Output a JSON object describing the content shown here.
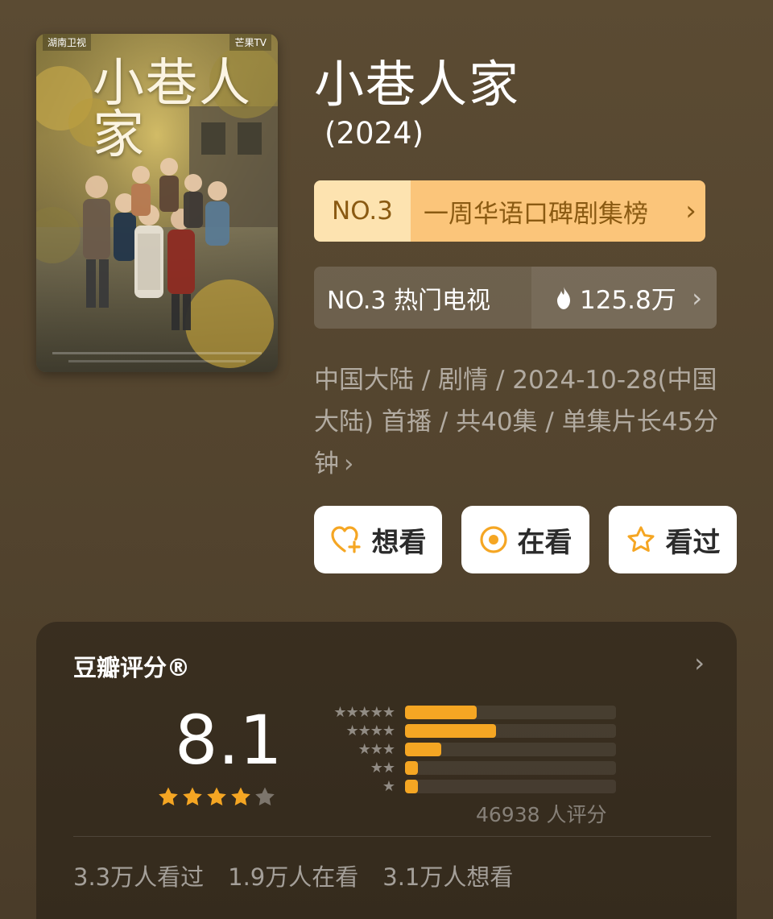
{
  "poster": {
    "title_text": "小巷人家",
    "top_left_text": "湖南卫视",
    "top_right_text": "芒果TV"
  },
  "title": "小巷人家",
  "year": "(2024)",
  "rank_chip": {
    "no": "NO.3",
    "label": "一周华语口碑剧集榜",
    "chevron": "›"
  },
  "hot_chip": {
    "label": "NO.3 热门电视",
    "value": "125.8万",
    "icon": "flame-icon",
    "chevron": "›"
  },
  "meta": {
    "text": "中国大陆 / 剧情 / 2024-10-28(中国大陆) 首播 / 共40集 / 单集片长45分钟",
    "chevron": "›"
  },
  "actions": [
    {
      "label": "想看",
      "icon": "heart-plus-icon"
    },
    {
      "label": "在看",
      "icon": "target-circle-icon"
    },
    {
      "label": "看过",
      "icon": "star-outline-icon"
    }
  ],
  "rating": {
    "title": "豆瓣评分®",
    "chevron": "›",
    "score": "8.1",
    "stars_filled": 4,
    "stars_total": 5,
    "distribution": [
      {
        "stars": 5,
        "fraction": 0.34
      },
      {
        "stars": 4,
        "fraction": 0.43
      },
      {
        "stars": 3,
        "fraction": 0.17
      },
      {
        "stars": 2,
        "fraction": 0.06
      },
      {
        "stars": 1,
        "fraction": 0.06
      }
    ],
    "count_text": "46938 人评分",
    "stats": [
      "3.3万人看过",
      "1.9万人在看",
      "3.1万人想看"
    ]
  },
  "colors": {
    "accent_orange": "#f5a623",
    "rank_chip_light": "#fde3b0",
    "rank_chip_dark": "#fbc57a",
    "rank_text": "#8a5a12"
  }
}
